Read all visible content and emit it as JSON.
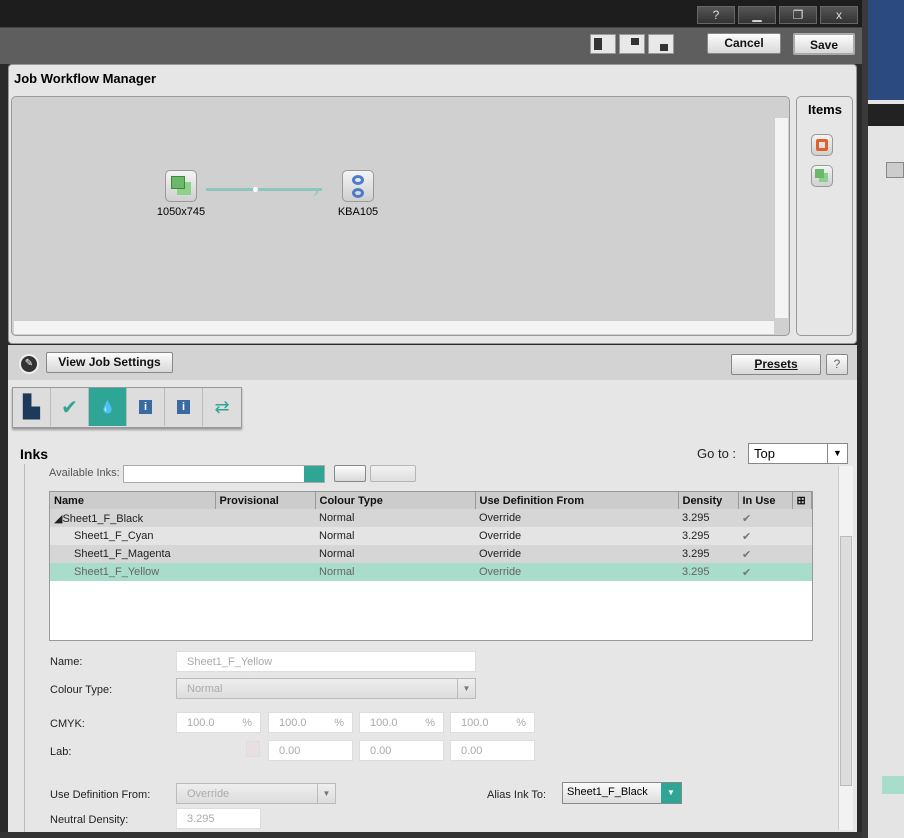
{
  "window": {
    "help": "?",
    "minimize": "▁",
    "restore": "❐",
    "close": "x",
    "cancel": "Cancel",
    "save": "Save"
  },
  "workflow": {
    "title": "Job Workflow Manager",
    "items_title": "Items",
    "nodes": [
      {
        "label": "1050x745",
        "icon": "sheet-icon"
      },
      {
        "label": "KBA105",
        "icon": "press-icon"
      }
    ]
  },
  "settings": {
    "view_job_settings": "View Job Settings",
    "presets": "Presets",
    "help": "?",
    "section": "Inks",
    "goto_label": "Go to :",
    "goto_value": "Top",
    "available_inks": "Available Inks:",
    "tabs": [
      "import-icon",
      "preflight-icon",
      "inks-icon",
      "job-info-icon",
      "customer-info-icon",
      "output-icon"
    ]
  },
  "table": {
    "columns": [
      "Name",
      "Provisional",
      "Colour Type",
      "Use Definition From",
      "Density",
      "In Use"
    ],
    "rows": [
      {
        "name": "◢Sheet1_F_Black",
        "provisional": "",
        "type": "Normal",
        "def": "Override",
        "density": "3.295",
        "inuse": "✔"
      },
      {
        "name": "Sheet1_F_Cyan",
        "provisional": "",
        "type": "Normal",
        "def": "Override",
        "density": "3.295",
        "inuse": "✔"
      },
      {
        "name": "Sheet1_F_Magenta",
        "provisional": "",
        "type": "Normal",
        "def": "Override",
        "density": "3.295",
        "inuse": "✔"
      },
      {
        "name": "Sheet1_F_Yellow",
        "provisional": "",
        "type": "Normal",
        "def": "Override",
        "density": "3.295",
        "inuse": "✔",
        "selected": true
      }
    ]
  },
  "form": {
    "name_label": "Name:",
    "name_value": "Sheet1_F_Yellow",
    "colour_type_label": "Colour Type:",
    "colour_type_value": "Normal",
    "cmyk_label": "CMYK:",
    "cmyk": [
      "100.0",
      "100.0",
      "100.0",
      "100.0"
    ],
    "pct": "%",
    "lab_label": "Lab:",
    "lab": [
      "0.00",
      "0.00",
      "0.00"
    ],
    "use_def_label": "Use Definition From:",
    "use_def_value": "Override",
    "alias_label": "Alias Ink To:",
    "alias_value": "Sheet1_F_Black",
    "nd_label": "Neutral Density:",
    "nd_value": "3.295"
  },
  "colors": {
    "accent": "#2fa595",
    "selected_row": "#a8dccb"
  }
}
